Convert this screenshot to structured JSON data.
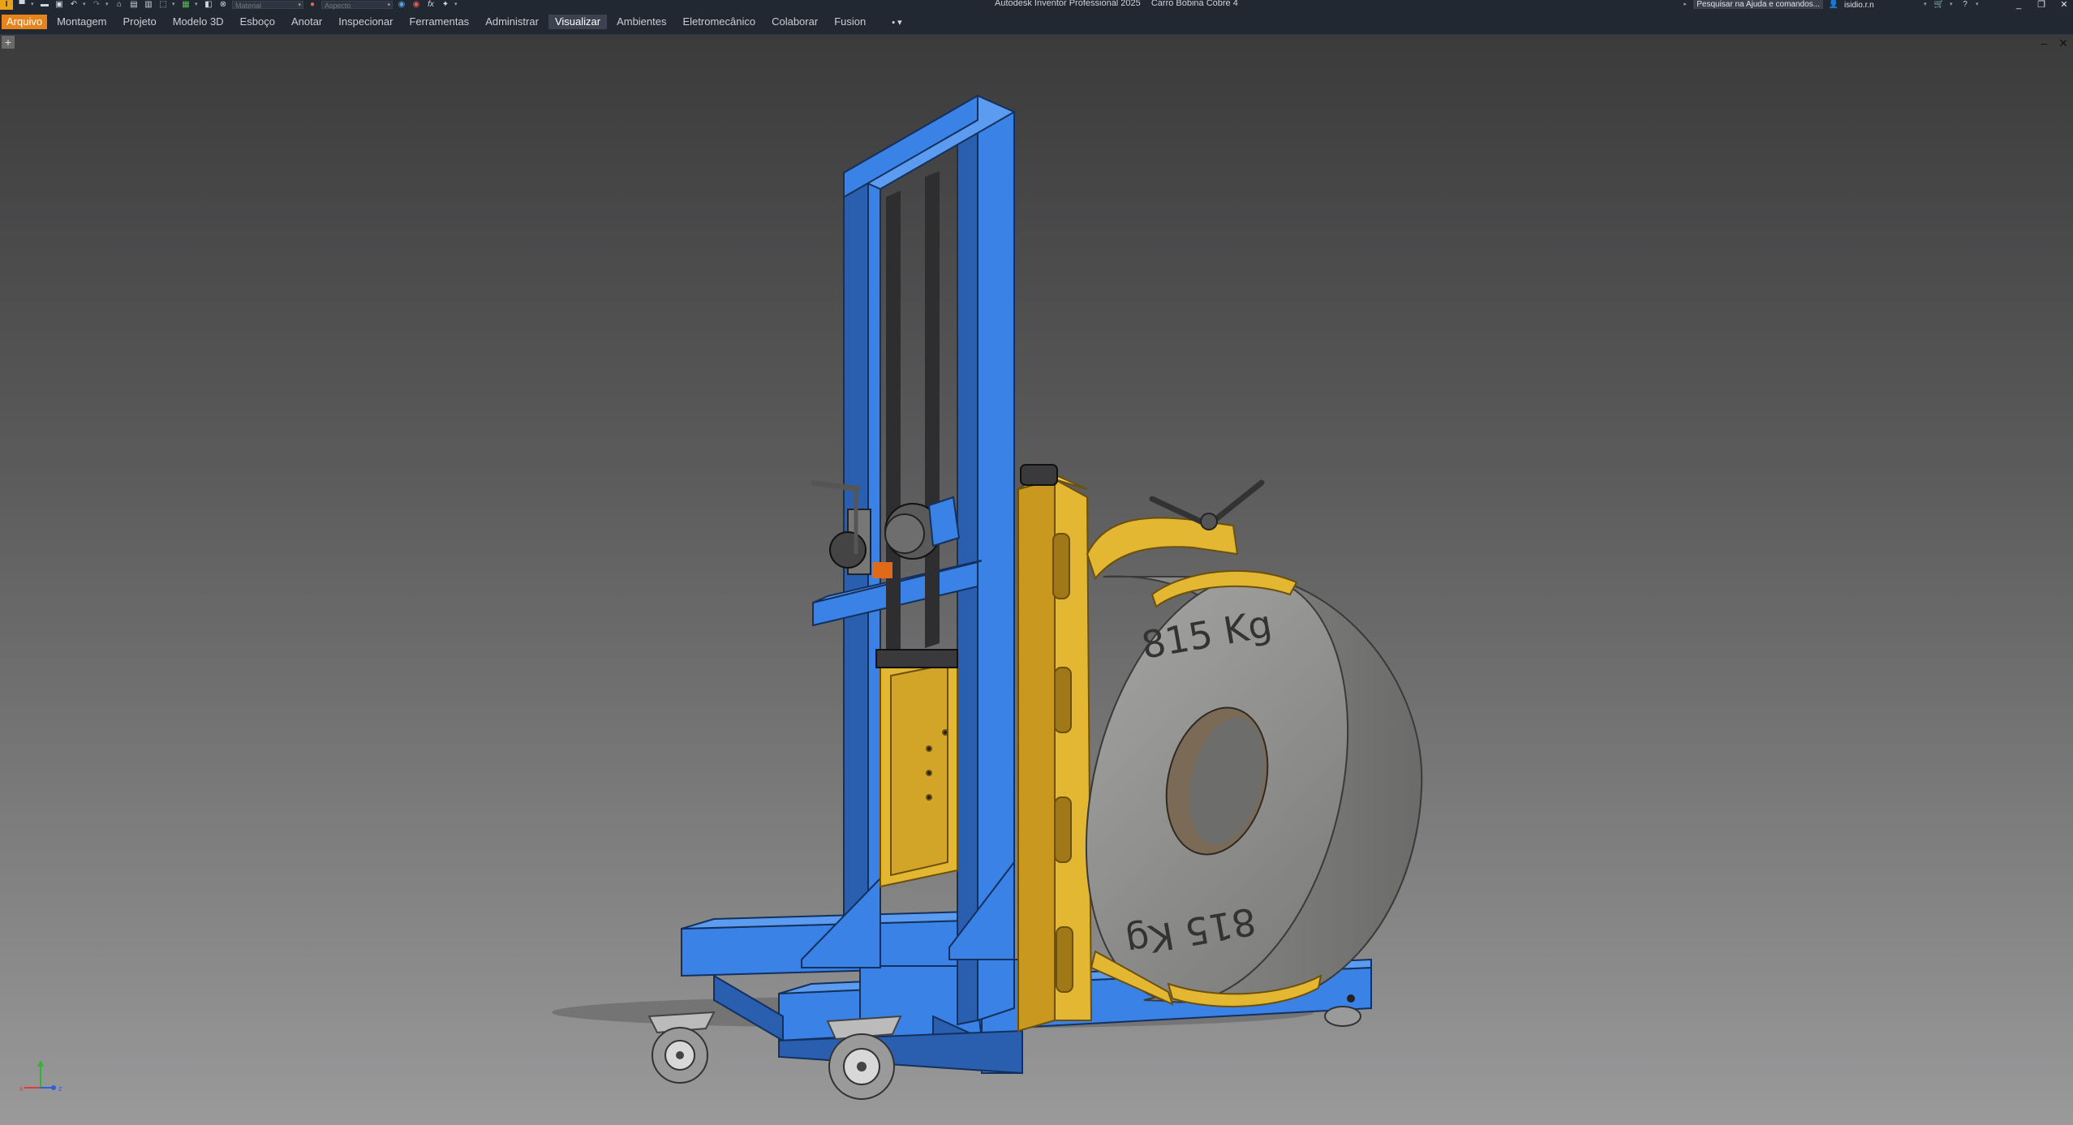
{
  "window": {
    "app_title": "Autodesk Inventor Professional 2025",
    "document_title": "Carro Bobina Cobre 4",
    "help_search": "Pesquisar na Ajuda e comandos...",
    "user": "isidio.r.n",
    "controls": [
      "_",
      "❐",
      "✕"
    ]
  },
  "quick_access": {
    "logo": "I",
    "material_placeholder": "Material",
    "appearance_placeholder": "Aspecto",
    "fx_label": "fx"
  },
  "ribbon": {
    "file_tab": "Arquivo",
    "tabs": [
      "Montagem",
      "Projeto",
      "Modelo 3D",
      "Esboço",
      "Anotar",
      "Inspecionar",
      "Ferramentas",
      "Administrar",
      "Visualizar",
      "Ambientes",
      "Eletromecânico",
      "Colaborar",
      "Fusion"
    ],
    "active_tab": "Visualizar",
    "extra": "▪ ▾"
  },
  "viewport": {
    "new_tab": "+",
    "doc_controls": [
      "–",
      "✕"
    ]
  },
  "model": {
    "coil_label_top": "815 Kg",
    "coil_label_bottom": "815 Kg",
    "colors": {
      "frame": "#3b82e6",
      "frame_dark": "#2a5fb0",
      "yellow": "#e4b733",
      "yellow_dark": "#b98d1d",
      "coil": "#8e8e8c",
      "coil_dark": "#6f6f6d"
    }
  },
  "triad": {
    "x": "x",
    "y": "y",
    "z": "z"
  }
}
